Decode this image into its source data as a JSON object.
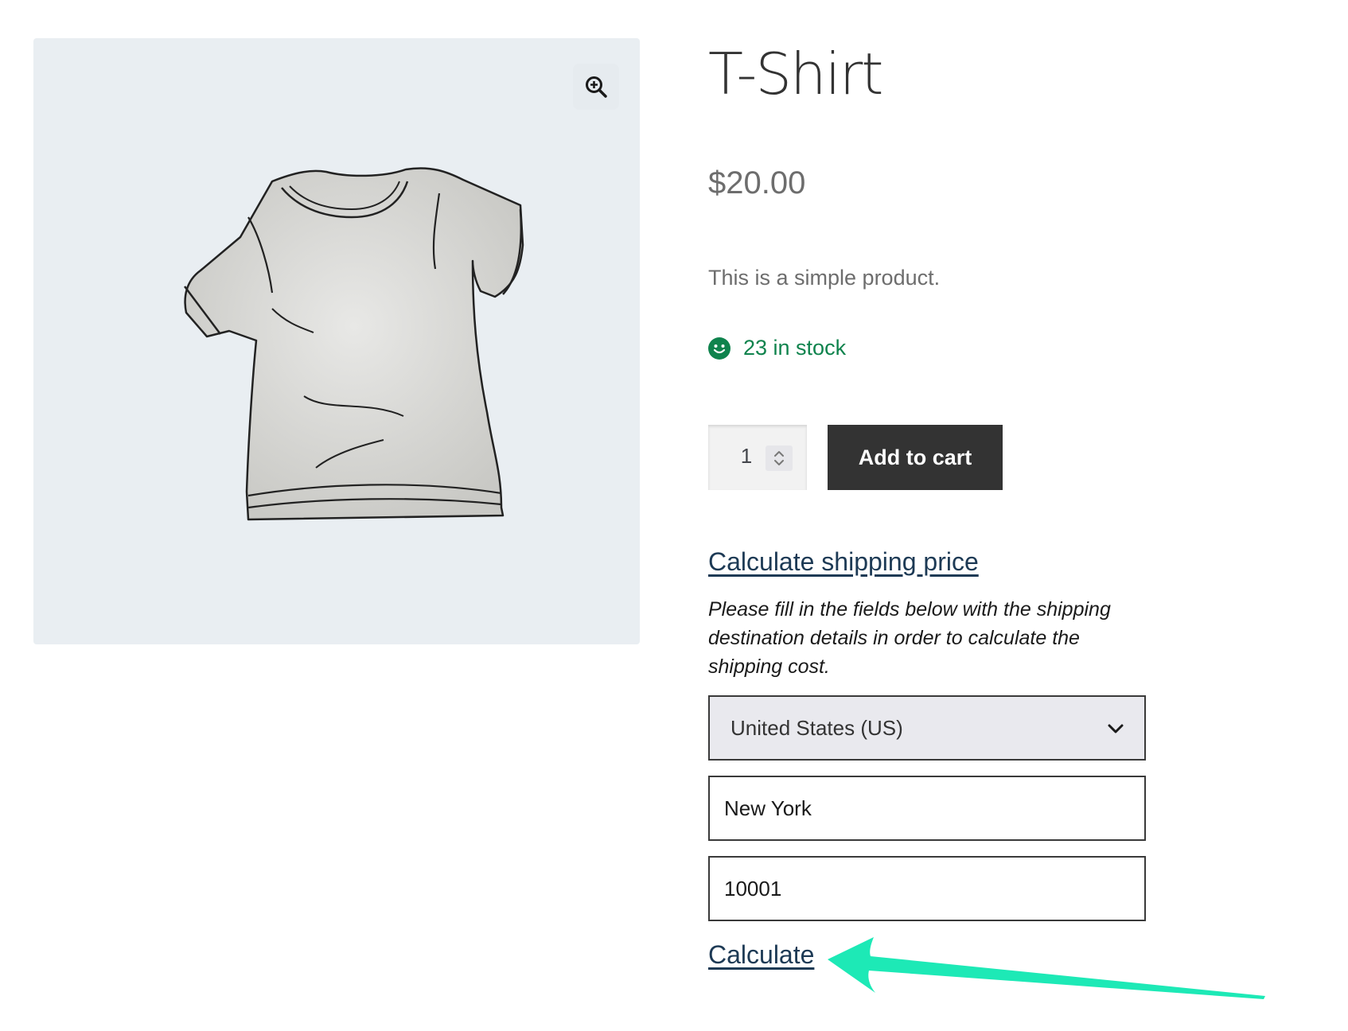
{
  "product": {
    "title": "T-Shirt",
    "price": "$20.00",
    "short_description": "This is a simple product.",
    "stock_text": "23 in stock",
    "image_icon": "t-shirt-illustration"
  },
  "gallery": {
    "zoom_icon": "magnifier-zoom-icon"
  },
  "cart": {
    "quantity": "1",
    "add_to_cart_label": "Add to cart"
  },
  "shipping": {
    "toggle_label": "Calculate shipping price",
    "info_text": "Please fill in the fields below with the shipping destination details in order to calculate the shipping cost.",
    "country_selected": "United States (US)",
    "city_value": "New York",
    "zip_value": "10001",
    "calculate_label": "Calculate"
  },
  "colors": {
    "in_stock": "#0f834d",
    "button_bg": "#333333",
    "link": "#1d3a55",
    "annotation_arrow": "#1de9b6",
    "gallery_bg": "#e9eef2"
  }
}
